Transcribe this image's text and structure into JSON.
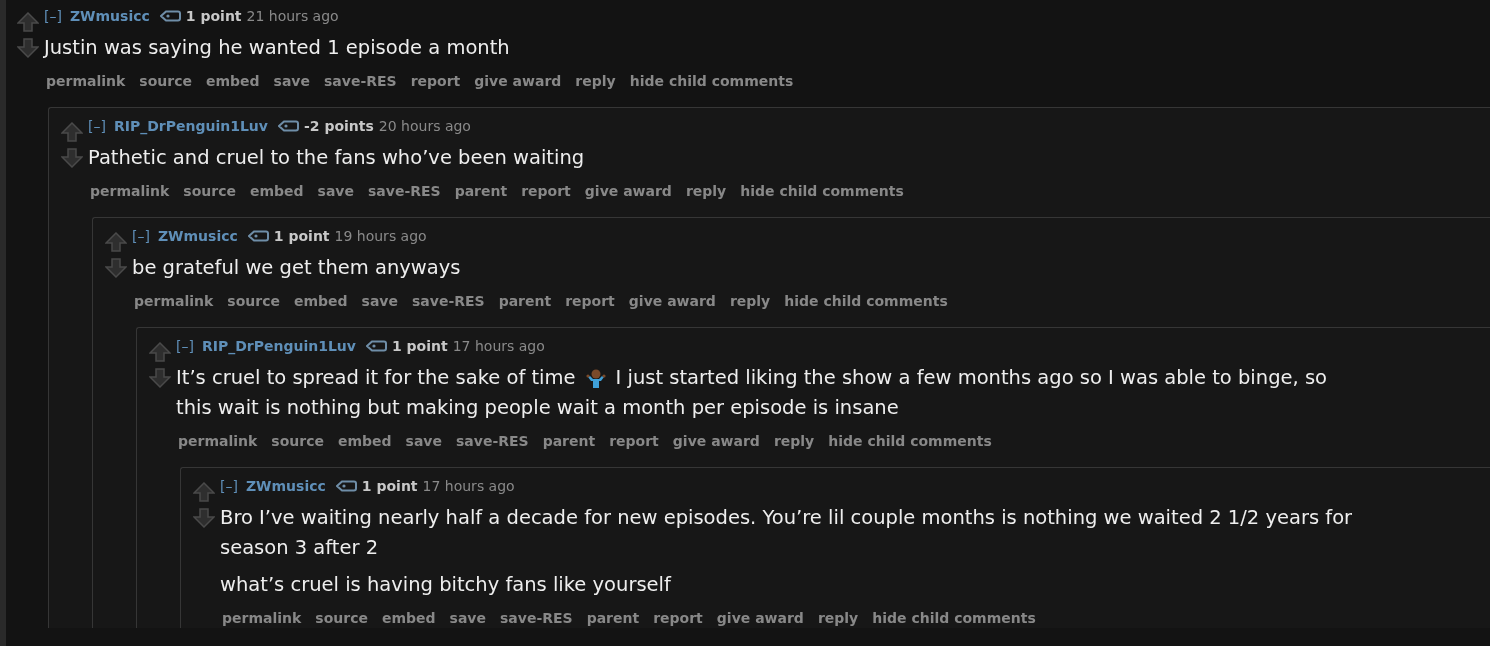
{
  "comments": [
    {
      "toggle": "[–]",
      "author": "ZWmusicc",
      "score": "1 point",
      "time": "21 hours ago",
      "body": [
        [
          [
            {
              "kind": "text",
              "text": "Justin was saying he wanted 1 episode a month"
            }
          ]
        ]
      ],
      "actions": [
        "permalink",
        "source",
        "embed",
        "save",
        "save-RES",
        "report",
        "give award",
        "reply",
        "hide child comments"
      ],
      "children": [
        {
          "toggle": "[–]",
          "author": "RIP_DrPenguin1Luv",
          "score": "-2 points",
          "time": "20 hours ago",
          "body": [
            [
              [
                {
                  "kind": "text",
                  "text": "Pathetic and cruel to the fans who’ve been waiting"
                }
              ]
            ]
          ],
          "actions": [
            "permalink",
            "source",
            "embed",
            "save",
            "save-RES",
            "parent",
            "report",
            "give award",
            "reply",
            "hide child comments"
          ],
          "children": [
            {
              "toggle": "[–]",
              "author": "ZWmusicc",
              "score": "1 point",
              "time": "19 hours ago",
              "body": [
                [
                  [
                    {
                      "kind": "text",
                      "text": "be grateful we get them anyways"
                    }
                  ]
                ]
              ],
              "actions": [
                "permalink",
                "source",
                "embed",
                "save",
                "save-RES",
                "parent",
                "report",
                "give award",
                "reply",
                "hide child comments"
              ],
              "children": [
                {
                  "toggle": "[–]",
                  "author": "RIP_DrPenguin1Luv",
                  "score": "1 point",
                  "time": "17 hours ago",
                  "body": [
                    [
                      [
                        {
                          "kind": "text",
                          "text": "It’s cruel to spread it for the sake of time"
                        },
                        {
                          "kind": "emoji"
                        },
                        {
                          "kind": "text",
                          "text": "I just started liking the show a few months ago so I was able to binge, so"
                        }
                      ],
                      [
                        {
                          "kind": "text",
                          "text": "this wait is nothing but making people wait a month per episode is insane"
                        }
                      ]
                    ]
                  ],
                  "actions": [
                    "permalink",
                    "source",
                    "embed",
                    "save",
                    "save-RES",
                    "parent",
                    "report",
                    "give award",
                    "reply",
                    "hide child comments"
                  ],
                  "children": [
                    {
                      "toggle": "[–]",
                      "author": "ZWmusicc",
                      "score": "1 point",
                      "time": "17 hours ago",
                      "body": [
                        [
                          [
                            {
                              "kind": "text",
                              "text": "Bro I’ve waiting nearly half a decade for new episodes. You’re lil couple months is nothing we waited 2 1/2 years for"
                            }
                          ],
                          [
                            {
                              "kind": "text",
                              "text": "season 3 after 2"
                            }
                          ]
                        ],
                        [
                          [
                            {
                              "kind": "text",
                              "text": "what’s cruel is having bitchy fans like yourself"
                            }
                          ]
                        ]
                      ],
                      "actions": [
                        "permalink",
                        "source",
                        "embed",
                        "save",
                        "save-RES",
                        "parent",
                        "report",
                        "give award",
                        "reply",
                        "hide child comments"
                      ]
                    }
                  ]
                }
              ]
            }
          ]
        }
      ]
    }
  ]
}
